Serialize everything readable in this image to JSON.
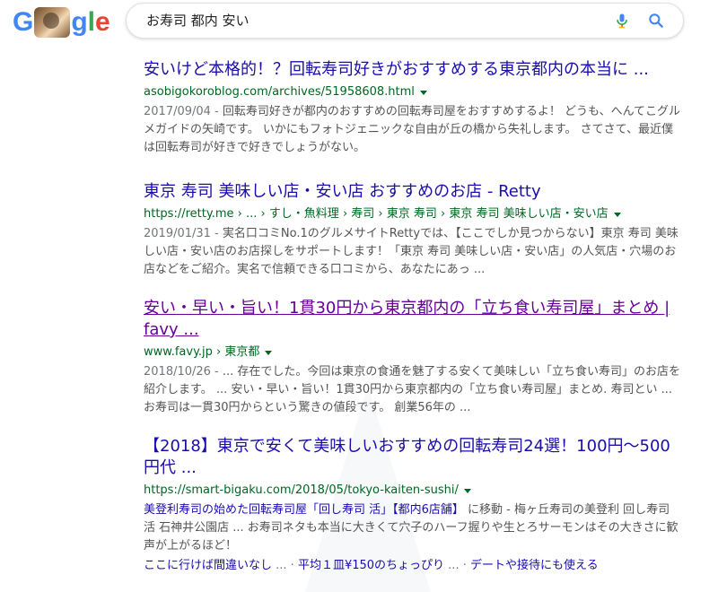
{
  "header": {
    "logo_letters": [
      {
        "char": "G",
        "color": "#4285F4"
      },
      {
        "char": "",
        "color": "#EA4335"
      },
      {
        "char": "g",
        "color": "#4285F4"
      },
      {
        "char": "l",
        "color": "#34A853"
      },
      {
        "char": "e",
        "color": "#EA4335"
      }
    ],
    "search_query": "お寿司 都内 安い"
  },
  "results": [
    {
      "title": "安いけど本格的！？回転寿司好きがおすすめする東京都内の本当に ...",
      "url": "asobigokoroblog.com/archives/51958608.html",
      "date": "2017/09/04 - ",
      "snippet": "回転寿司好きが都内のおすすめの回転寿司屋をおすすめするよ！ どうも、へんてこグルメガイドの矢崎です。 いかにもフォトジェニックな自由が丘の橋から失礼します。 さてさて、最近僕は回転寿司が好きで好きでしょうがない。"
    },
    {
      "title": "東京 寿司 美味しい店・安い店 おすすめのお店 - Retty",
      "url": "https://retty.me › ... › すし・魚料理 › 寿司 › 東京 寿司 › 東京 寿司 美味しい店・安い店",
      "date": "2019/01/31 - ",
      "snippet": "実名口コミNo.1のグルメサイトRettyでは、【ここでしか見つからない】東京 寿司 美味しい店・安い店のお店探しをサポートします！「東京 寿司 美味しい店・安い店」の人気店・穴場のお店などをご紹介。実名で信頼できる口コミから、あなたにあっ ..."
    },
    {
      "title": "安い・早い・旨い！1貫30円から東京都内の「立ち食い寿司屋」まとめ | favy ...",
      "url": "www.favy.jp › 東京都",
      "date": "2018/10/26 - ",
      "snippet": "... 存在でした。今回は東京の食通を魅了する安くて美味しい「立ち食い寿司」のお店を紹介します。 ... 安い・早い・旨い！1貫30円から東京都内の「立ち食い寿司屋」まとめ. 寿司とい ... お寿司は一貫30円からという驚きの値段です。 創業56年の ..."
    },
    {
      "title": "【2018】東京で安くて美味しいおすすめの回転寿司24選！100円〜500円代 ...",
      "url": "https://smart-bigaku.com/2018/05/tokyo-kaiten-sushi/",
      "snippet_link": "美登利寿司の始めた回転寿司屋「回し寿司 活」【都内6店舗】",
      "snippet": " に移動 - 梅ヶ丘寿司の美登利 回し寿司 活 石神井公園店 ... お寿司ネタも本当に大きくて穴子のハーフ握りや生とろサーモンはその大きさに歓声が上がるほど！",
      "sitelinks": [
        "ここに行けば間違いなし",
        "平均１皿¥150のちょっぴり",
        "デートや接待にも使える"
      ],
      "sitelink_sep": " ... · "
    }
  ],
  "colors": {
    "link": "#1a0dab",
    "visited": "#660099",
    "url": "#006621",
    "snippet": "#545454"
  }
}
